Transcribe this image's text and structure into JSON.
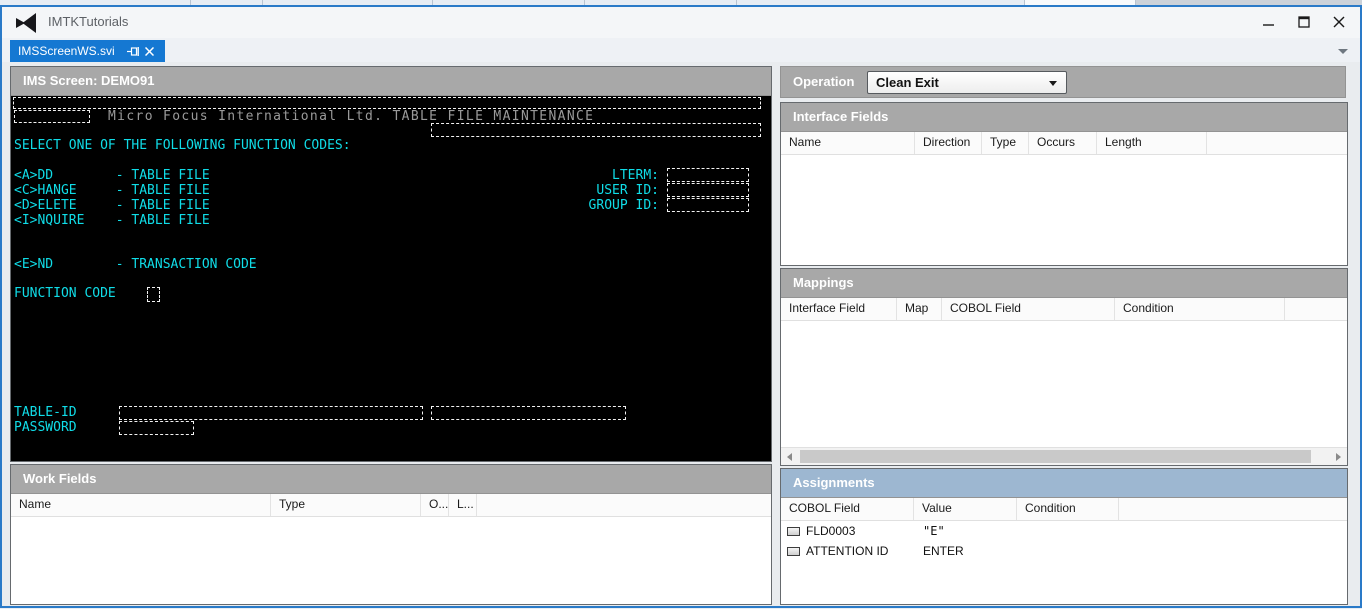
{
  "window": {
    "title": "IMTKTutorials"
  },
  "tab": {
    "label": "IMSScreenWS.svi"
  },
  "colors": {
    "accent_blue": "#1578d2",
    "window_border": "#2a7ac8",
    "panel_header_gray": "#a8a8a8",
    "focused_header_blue": "#9db7d1",
    "terminal_bg": "#000000",
    "terminal_cyan": "#10dde8",
    "terminal_gray": "#9a9a9a"
  },
  "icons": {
    "vs_logo": "visual-studio-bowtie",
    "tab_pin": "pushpin-horizontal",
    "tab_close": "x-cross",
    "minimize": "horizontal-bar",
    "maximize": "square-outline",
    "close": "x-cross",
    "combo_arrow": "triangle-down",
    "scroll_left": "triangle-left",
    "scroll_right": "triangle-right",
    "assignment_row": "small-3d-box"
  },
  "ims_screen": {
    "title": "IMS Screen: DEMO91",
    "banner": "Micro Focus International Ltd. TABLE FILE MAINTENANCE",
    "select_line": "SELECT ONE OF THE FOLLOWING FUNCTION CODES:",
    "menu": [
      "<A>DD        - TABLE FILE",
      "<C>HANGE     - TABLE FILE",
      "<D>ELETE     - TABLE FILE",
      "<I>NQUIRE    - TABLE FILE"
    ],
    "end_line": "<E>ND        - TRANSACTION CODE",
    "right_labels": [
      "LTERM:",
      "USER ID:",
      "GROUP ID:"
    ],
    "function_code_label": "FUNCTION CODE",
    "table_id_label": "TABLE-ID",
    "password_label": "PASSWORD"
  },
  "operation": {
    "label": "Operation",
    "selected": "Clean Exit"
  },
  "interface_fields": {
    "title": "Interface Fields",
    "columns": [
      "Name",
      "Direction",
      "Type",
      "Occurs",
      "Length"
    ],
    "rows": []
  },
  "mappings": {
    "title": "Mappings",
    "columns": [
      "Interface Field",
      "Map",
      "COBOL Field",
      "Condition"
    ],
    "rows": []
  },
  "work_fields": {
    "title": "Work Fields",
    "columns": [
      "Name",
      "Type",
      "O...",
      "L..."
    ],
    "rows": []
  },
  "assignments": {
    "title": "Assignments",
    "columns": [
      "COBOL Field",
      "Value",
      "Condition"
    ],
    "rows": [
      {
        "cobol_field": "FLD0003",
        "value": "\"E\"",
        "condition": ""
      },
      {
        "cobol_field": "ATTENTION ID",
        "value": "ENTER",
        "condition": ""
      }
    ]
  }
}
